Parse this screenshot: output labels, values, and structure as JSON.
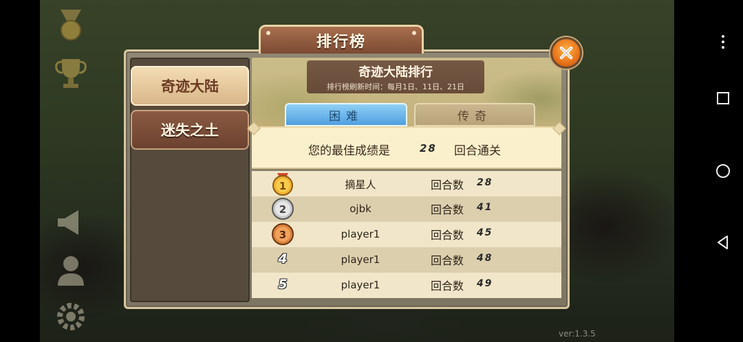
{
  "window": {
    "title": "排行榜"
  },
  "sidebar": {
    "items": [
      {
        "label": "奇迹大陆",
        "active": true
      },
      {
        "label": "迷失之土",
        "active": false
      }
    ]
  },
  "header": {
    "title": "奇迹大陆排行",
    "subtitle": "排行榜刷新时间：每月1日、11日、21日"
  },
  "difficulty_tabs": [
    {
      "label": "困难",
      "active": true
    },
    {
      "label": "传奇",
      "active": false
    }
  ],
  "best": {
    "prefix": "您的最佳成绩是",
    "value": "28",
    "suffix": "回合通关"
  },
  "leaderboard": {
    "rows": [
      {
        "rank": "1",
        "name": "摘星人",
        "rounds_label": "回合数",
        "rounds": "28"
      },
      {
        "rank": "2",
        "name": "ojbk",
        "rounds_label": "回合数",
        "rounds": "41"
      },
      {
        "rank": "3",
        "name": "player1",
        "rounds_label": "回合数",
        "rounds": "45"
      },
      {
        "rank": "4",
        "name": "player1",
        "rounds_label": "回合数",
        "rounds": "48"
      },
      {
        "rank": "5",
        "name": "player1",
        "rounds_label": "回合数",
        "rounds": "49"
      }
    ]
  },
  "footer": {
    "version": "ver:1.3.5"
  },
  "icons": {
    "close": "close-icon",
    "medal": "medal-icon",
    "trophy": "trophy-icon",
    "megaphone": "megaphone-icon",
    "profile": "profile-icon",
    "settings": "gear-icon"
  },
  "colors": {
    "accent_gold": "#f2b233",
    "silver": "#c8c8c8",
    "bronze": "#d9823c",
    "active_tab_blue": "#4f9fe0"
  }
}
